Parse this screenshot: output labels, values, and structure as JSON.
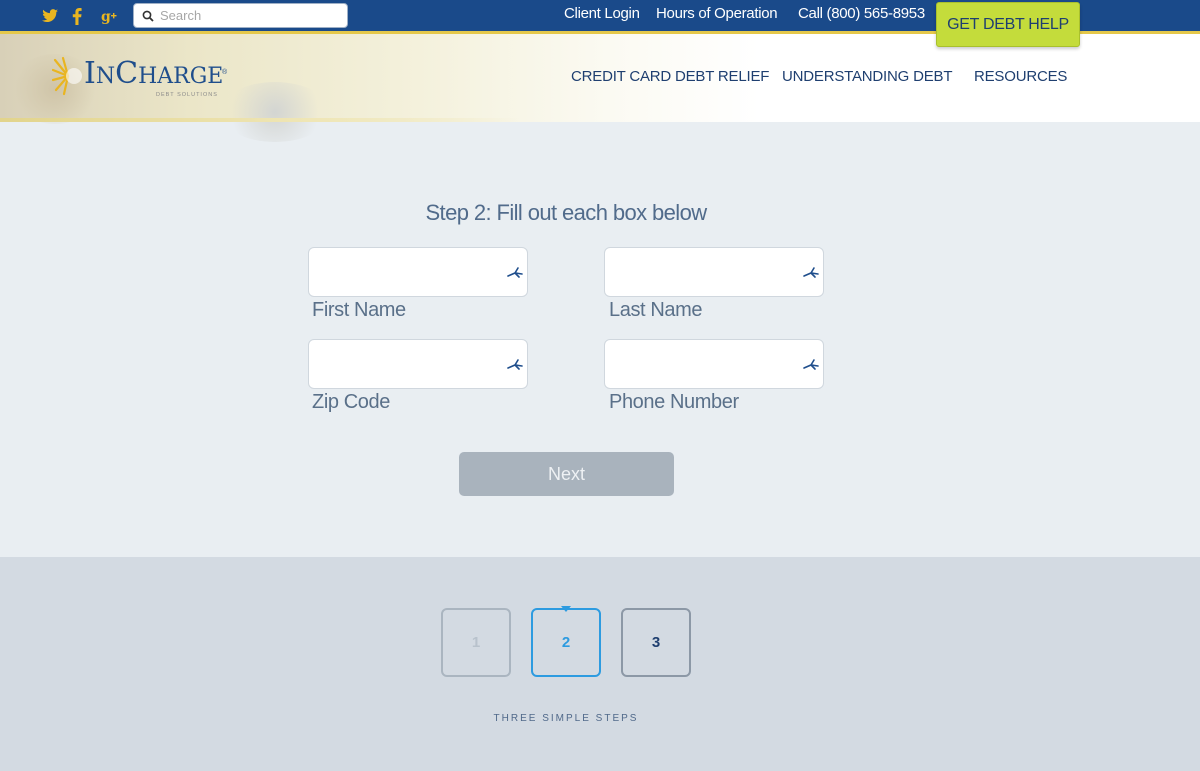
{
  "topbar": {
    "social": [
      {
        "name": "twitter",
        "glyph": "🐦"
      },
      {
        "name": "facebook",
        "glyph": "f"
      },
      {
        "name": "google-plus",
        "glyph": "g+"
      }
    ],
    "search_placeholder": "Search",
    "links": {
      "client_login": "Client Login",
      "hours": "Hours of Operation",
      "call": "Call (800) 565-8953"
    },
    "cta_label": "GET DEBT HELP"
  },
  "header": {
    "logo": {
      "brand": "InCharge",
      "sub": "DEBT SOLUTIONS"
    },
    "nav": [
      "CREDIT CARD DEBT RELIEF",
      "UNDERSTANDING DEBT",
      "RESOURCES"
    ]
  },
  "form": {
    "title": "Step 2: Fill out each box below",
    "fields": [
      {
        "label": "First Name",
        "value": ""
      },
      {
        "label": "Last Name",
        "value": ""
      },
      {
        "label": "Zip Code",
        "value": ""
      },
      {
        "label": "Phone Number",
        "value": ""
      }
    ],
    "next_label": "Next"
  },
  "steps": {
    "items": [
      "1",
      "2",
      "3"
    ],
    "current": "2",
    "caption": "THREE SIMPLE STEPS"
  },
  "colors": {
    "topbar": "#1a4a8a",
    "cta": "#c4dc3b",
    "active_step": "#2d9be0",
    "next_button": "#a9b3bd"
  }
}
